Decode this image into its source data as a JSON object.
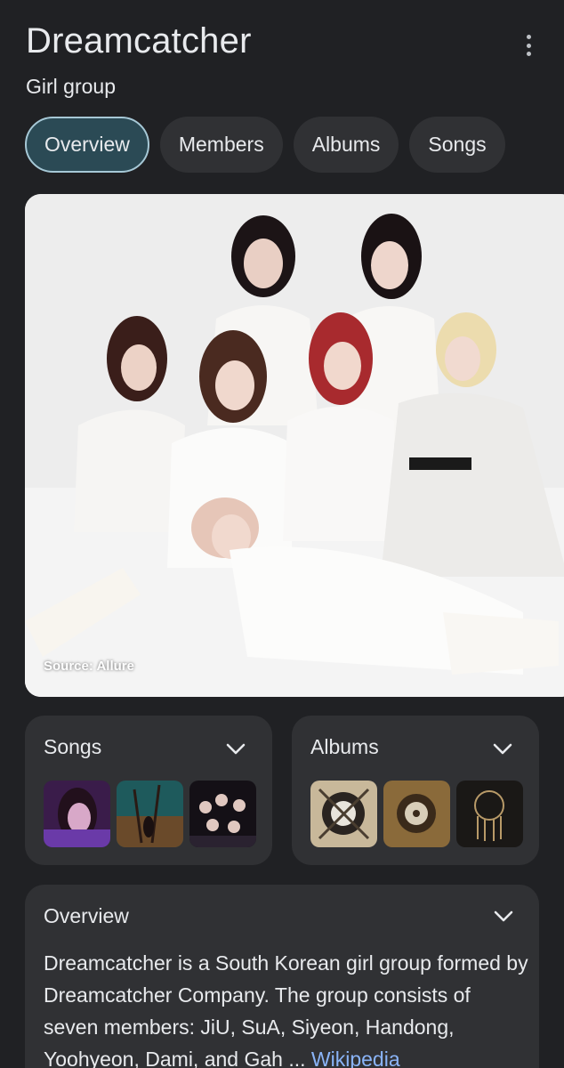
{
  "header": {
    "title": "Dreamcatcher",
    "subtitle": "Girl group",
    "more_icon": "more-vert-icon"
  },
  "tabs": [
    {
      "label": "Overview",
      "active": true
    },
    {
      "label": "Members",
      "active": false
    },
    {
      "label": "Albums",
      "active": false
    },
    {
      "label": "Songs",
      "active": false
    }
  ],
  "hero": {
    "source": "Source: Allure"
  },
  "songs_card": {
    "title": "Songs",
    "icon": "chevron-down-icon"
  },
  "albums_card": {
    "title": "Albums",
    "icon": "chevron-down-icon"
  },
  "overview_card": {
    "title": "Overview",
    "icon": "chevron-down-icon",
    "text": "Dreamcatcher is a South Korean girl group formed by Dreamcatcher Company. The group consists of seven members: JiU, SuA, Siyeon, Handong, Yoohyeon, Dami, and Gah ...",
    "link": "Wikipedia"
  },
  "colors": {
    "background": "#202124",
    "card": "#303134",
    "active_tab_bg": "#2b4a55",
    "active_tab_border": "#a6c8d6",
    "link": "#8ab4f8"
  }
}
